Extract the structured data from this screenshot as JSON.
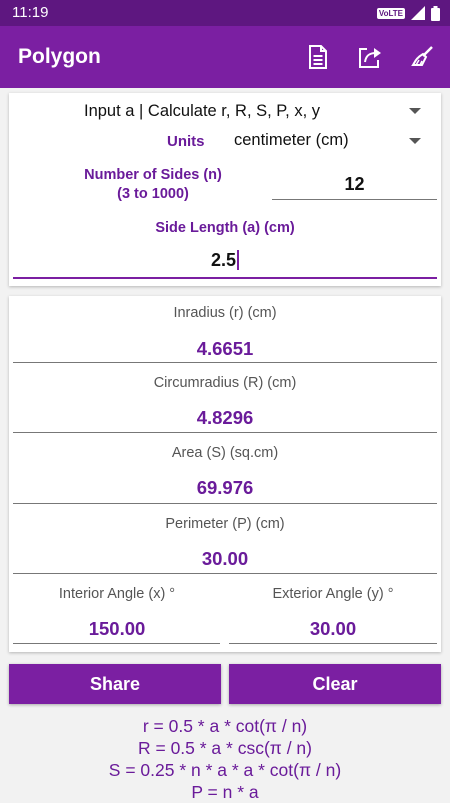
{
  "status_bar": {
    "time": "11:19",
    "network_badge": "VoLTE"
  },
  "app_bar": {
    "title": "Polygon",
    "icons": [
      "document-icon",
      "share-icon",
      "clear-brush-icon"
    ]
  },
  "input": {
    "mode": "Input a | Calculate r, R, S, P, x, y",
    "units_label": "Units",
    "units_value": "centimeter (cm)",
    "sides_label": "Number of Sides (n)",
    "sides_range": "(3 to 1000)",
    "sides_value": "12",
    "side_length_label": "Side Length (a) (cm)",
    "side_length_value": "2.5"
  },
  "results": {
    "inradius": {
      "label": "Inradius (r) (cm)",
      "value": "4.6651"
    },
    "circumradius": {
      "label": "Circumradius (R) (cm)",
      "value": "4.8296"
    },
    "area": {
      "label": "Area (S) (sq.cm)",
      "value": "69.976"
    },
    "perimeter": {
      "label": "Perimeter (P) (cm)",
      "value": "30.00"
    },
    "interior_angle": {
      "label": "Interior Angle (x) °",
      "value": "150.00"
    },
    "exterior_angle": {
      "label": "Exterior Angle (y) °",
      "value": "30.00"
    }
  },
  "buttons": {
    "share": "Share",
    "clear": "Clear"
  },
  "formulas": [
    "r = 0.5 * a * cot(π / n)",
    "R = 0.5 * a * csc(π / n)",
    "S = 0.25 * n * a * a * cot(π / n)",
    "P = n * a"
  ],
  "colors": {
    "primary": "#7b1fa2",
    "primary_dark": "#5e1780",
    "accent_text": "#6a1b9a"
  }
}
